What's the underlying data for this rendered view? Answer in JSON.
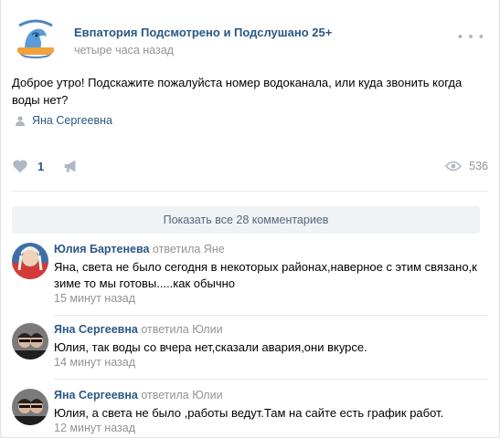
{
  "post": {
    "group_name": "Евпатория Подсмотрено и Подслушано 25+",
    "time": "четыре часа назад",
    "text": "Доброе утро! Подскажите пожалуйста номер водоканала, или куда звонить когда воды нет?",
    "signer": "Яна Сергеевна",
    "likes": "1",
    "views": "536",
    "more_icon": "ellipsis-icon",
    "colors": {
      "link": "#2a5885",
      "muted": "#939393",
      "icon": "#aeb7c2"
    }
  },
  "comments_section": {
    "show_all_label": "Показать все 28 комментариев",
    "items": [
      {
        "author": "Юлия Бартенева",
        "reply": "ответила Яне",
        "text": "Яна, света не было сегодня в некоторых районах,наверное с этим связано,к зиме то мы готовы.....как обычно",
        "time": "15 минут назад"
      },
      {
        "author": "Яна Сергеевна",
        "reply": "ответила Юлии",
        "text": "Юлия, так воды со вчера нет,сказали авария,они вкурсе.",
        "time": "14 минут назад"
      },
      {
        "author": "Яна Сергеевна",
        "reply": "ответила Юлии",
        "text": "Юлия, а света не было ,работы ведут.Там на сайте есть график работ.",
        "time": "12 минут назад"
      }
    ]
  }
}
